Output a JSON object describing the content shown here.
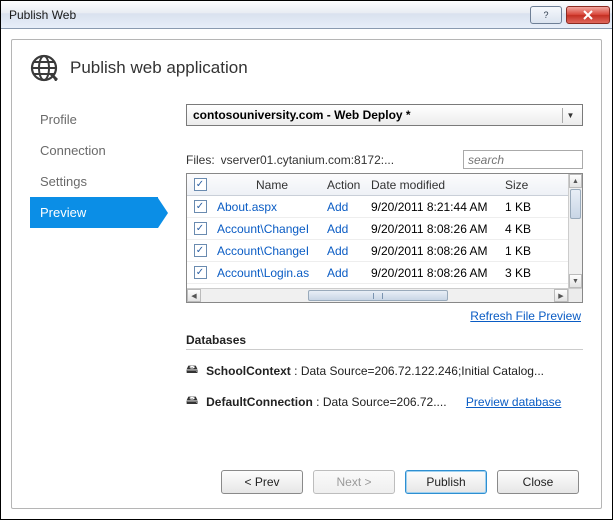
{
  "window": {
    "title": "Publish Web"
  },
  "heading": "Publish web application",
  "steps": [
    {
      "label": "Profile",
      "active": false
    },
    {
      "label": "Connection",
      "active": false
    },
    {
      "label": "Settings",
      "active": false
    },
    {
      "label": "Preview",
      "active": true
    }
  ],
  "profile_selector": "contosouniversity.com - Web Deploy *",
  "files": {
    "label": "Files:",
    "url": "vserver01.cytanium.com:8172:...",
    "search_placeholder": "search"
  },
  "grid": {
    "headers": {
      "name": "Name",
      "action": "Action",
      "date": "Date modified",
      "size": "Size"
    },
    "rows": [
      {
        "checked": true,
        "name": "About.aspx",
        "action": "Add",
        "date": "9/20/2011 8:21:44 AM",
        "size": "1 KB"
      },
      {
        "checked": true,
        "name": "Account\\ChangeI",
        "action": "Add",
        "date": "9/20/2011 8:08:26 AM",
        "size": "4 KB"
      },
      {
        "checked": true,
        "name": "Account\\ChangeI",
        "action": "Add",
        "date": "9/20/2011 8:08:26 AM",
        "size": "1 KB"
      },
      {
        "checked": true,
        "name": "Account\\Login.as",
        "action": "Add",
        "date": "9/20/2011 8:08:26 AM",
        "size": "3 KB"
      }
    ]
  },
  "refresh_link": "Refresh File Preview",
  "databases": {
    "heading": "Databases",
    "items": [
      {
        "name": "SchoolContext",
        "conn": "Data Source=206.72.122.246;Initial Catalog...",
        "preview": null
      },
      {
        "name": "DefaultConnection",
        "conn": "Data Source=206.72....",
        "preview": "Preview database"
      }
    ]
  },
  "buttons": {
    "prev": "< Prev",
    "next": "Next >",
    "publish": "Publish",
    "close": "Close"
  }
}
